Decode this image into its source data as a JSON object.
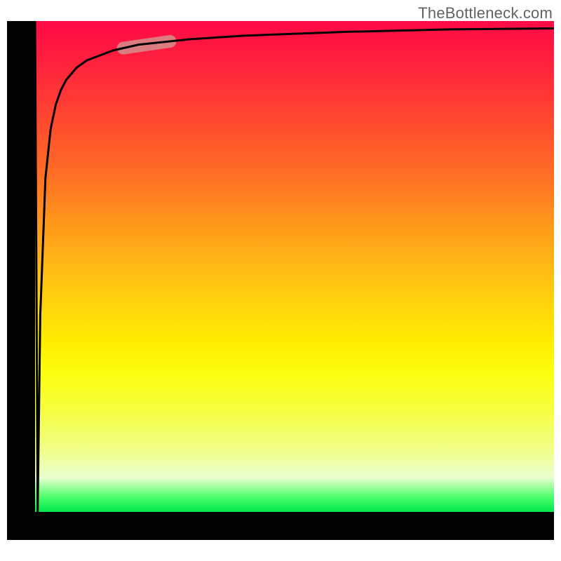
{
  "attribution": "TheBottleneck.com",
  "chart_data": {
    "type": "line",
    "title": "",
    "xlabel": "",
    "ylabel": "",
    "x": [
      0,
      0.5,
      1,
      2,
      3,
      4,
      5,
      6,
      8,
      10,
      15,
      20,
      30,
      40,
      60,
      80,
      100
    ],
    "values": [
      100,
      0,
      40,
      68,
      78,
      83,
      86,
      88,
      90.5,
      92,
      94,
      95.2,
      96.3,
      97,
      97.8,
      98.3,
      98.5
    ],
    "xlim": [
      0,
      100
    ],
    "ylim": [
      0,
      100
    ],
    "highlight_region": {
      "x_start": 17,
      "x_end": 26
    },
    "background_gradient": {
      "top": "#ff0a46",
      "bottom": "#00e850"
    }
  }
}
